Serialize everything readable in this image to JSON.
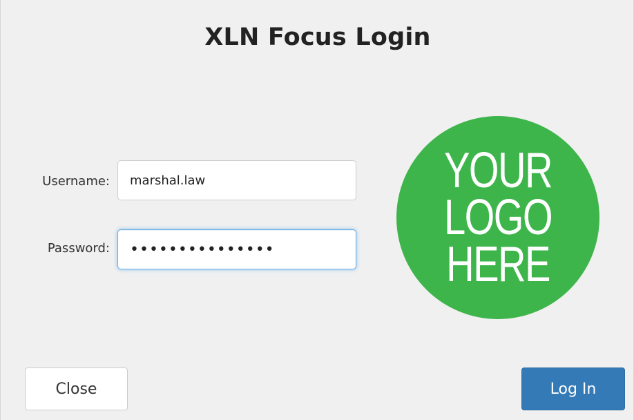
{
  "dialog": {
    "title": "XLN Focus Login",
    "username": {
      "label": "Username:",
      "value": "marshal.law"
    },
    "password": {
      "label": "Password:",
      "value": "•••••••••••••••",
      "focused": true
    },
    "logo": {
      "lines": [
        "YOUR",
        "LOGO",
        "HERE"
      ],
      "color": "#3db54a"
    },
    "buttons": {
      "close_label": "Close",
      "login_label": "Log In"
    },
    "colors": {
      "primary": "#337ab7",
      "background": "#f0f0f0",
      "focus_ring": "#66afe9"
    }
  }
}
